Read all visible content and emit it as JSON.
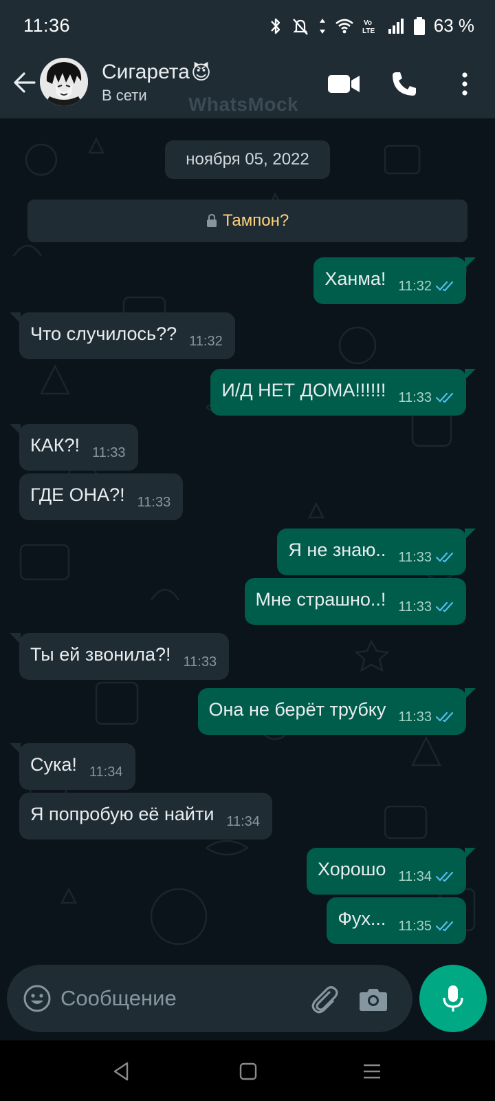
{
  "status_bar": {
    "time": "11:36",
    "battery_percent": "63 %",
    "volte_label": "Vo LTE"
  },
  "header": {
    "contact_name": "Сигарета",
    "contact_emoji": "😈",
    "contact_status": "В сети",
    "watermark": "WhatsMock"
  },
  "chat": {
    "date_chip": "ноября 05, 2022",
    "system_notice": "Тампон?",
    "messages": [
      {
        "dir": "out",
        "text": "Ханма!",
        "time": "11:32",
        "read": true
      },
      {
        "dir": "in",
        "text": "Что случилось??",
        "time": "11:32"
      },
      {
        "dir": "out",
        "text": "И/Д НЕТ ДОМА!!!!!!",
        "time": "11:33",
        "read": true
      },
      {
        "dir": "in",
        "text": "КАК?!",
        "time": "11:33"
      },
      {
        "dir": "in",
        "text": "ГДЕ ОНА?!",
        "time": "11:33"
      },
      {
        "dir": "out",
        "text": "Я не знаю..",
        "time": "11:33",
        "read": true
      },
      {
        "dir": "out",
        "text": "Мне страшно..!",
        "time": "11:33",
        "read": true
      },
      {
        "dir": "in",
        "text": "Ты ей звонила?!",
        "time": "11:33"
      },
      {
        "dir": "out",
        "text": "Она не берёт трубку",
        "time": "11:33",
        "read": true
      },
      {
        "dir": "in",
        "text": "Сука!",
        "time": "11:34"
      },
      {
        "dir": "in",
        "text": "Я попробую её найти",
        "time": "11:34"
      },
      {
        "dir": "out",
        "text": "Хорошо",
        "time": "11:34",
        "read": true
      },
      {
        "dir": "out",
        "text": "Фух...",
        "time": "11:35",
        "read": true
      }
    ]
  },
  "composer": {
    "placeholder": "Сообщение"
  },
  "icons": {
    "back": "arrow-left-icon",
    "video": "video-camera-icon",
    "call": "phone-icon",
    "menu": "more-vertical-icon",
    "emoji": "emoji-icon",
    "attach": "paperclip-icon",
    "camera": "camera-icon",
    "mic": "microphone-icon",
    "lock": "lock-icon",
    "read_ticks": "double-check-icon"
  },
  "colors": {
    "header_bg": "#1f2c34",
    "chat_bg": "#0b141a",
    "outgoing_bubble": "#005c4b",
    "incoming_bubble": "#1f2c34",
    "accent": "#00a884",
    "read_ticks": "#53bdeb",
    "system_text": "#ffd279"
  }
}
